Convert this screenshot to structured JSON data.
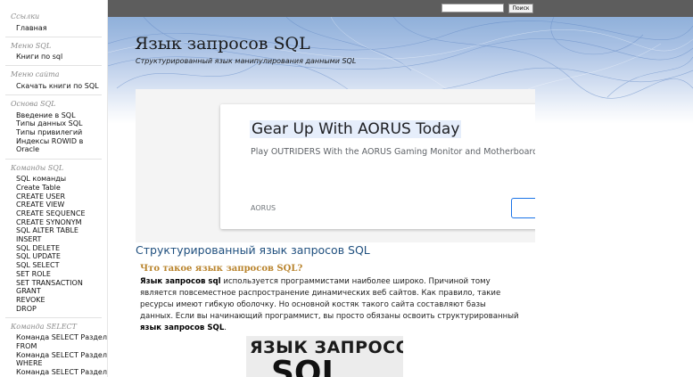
{
  "sidebar": {
    "sections": [
      {
        "title": "Ссылки",
        "items": [
          "Главная"
        ]
      },
      {
        "title": "Меню SQL",
        "items": [
          "Книги по sql"
        ]
      },
      {
        "title": "Меню сайта",
        "items": [
          "Скачать книги по SQL"
        ]
      },
      {
        "title": "Основа SQL",
        "items": [
          "Введение в SQL",
          "Типы данных SQL",
          "Типы привилегий",
          "Индексы ROWID в",
          "Oracle"
        ]
      },
      {
        "title": "Команды SQL",
        "items": [
          "SQL команды",
          "Create Table",
          "CREATE USER",
          "CREATE VIEW",
          "CREATE SEQUENCE",
          "CREATE SYNONYM",
          "SQL ALTER TABLE",
          "INSERT",
          "SQL DELETE",
          "SQL UPDATE",
          "SQL SELECT",
          "SET ROLE",
          "SET TRANSACTION",
          "GRANT",
          "REVOKE",
          "DROP"
        ]
      },
      {
        "title": "Команда SELECT",
        "items": [
          "Команда SELECT Раздел",
          "FROM",
          "Команда SELECT Раздел",
          "WHERE",
          "Команда SELECT Раздел"
        ]
      }
    ]
  },
  "topbar": {
    "search_placeholder": "",
    "search_button": "Поиск"
  },
  "header": {
    "title": "Язык запросов SQL",
    "subtitle": "Структурированный язык манипулирования данными SQL"
  },
  "ad": {
    "headline": "Gear Up With AORUS Today",
    "description": "Play OUTRIDERS With the AORUS Gaming Monitor and Motherboard",
    "brand": "AORUS"
  },
  "main": {
    "heading": "Структурированный язык запросов SQL",
    "subheading": "Что такое язык запросов SQL?",
    "para": {
      "l1_bold": "Язык запросов sql",
      "l1_rest": " используется программистами наиболее широко. Причиной тому",
      "l2": "является повсеместное распространение динамических веб сайтов. Как правило, такие",
      "l3": "ресурсы имеют гибкую оболочку. Но основной костяк такого сайта составляют базы",
      "l4": "данных. Если вы начинающий программист, вы просто обязаны освоить структурированный",
      "l5_bold": "язык запросов SQL",
      "l5_rest": "."
    },
    "image_text": {
      "line1": "ЯЗЫК ЗАПРОСОВ",
      "line2": "SQL"
    }
  }
}
